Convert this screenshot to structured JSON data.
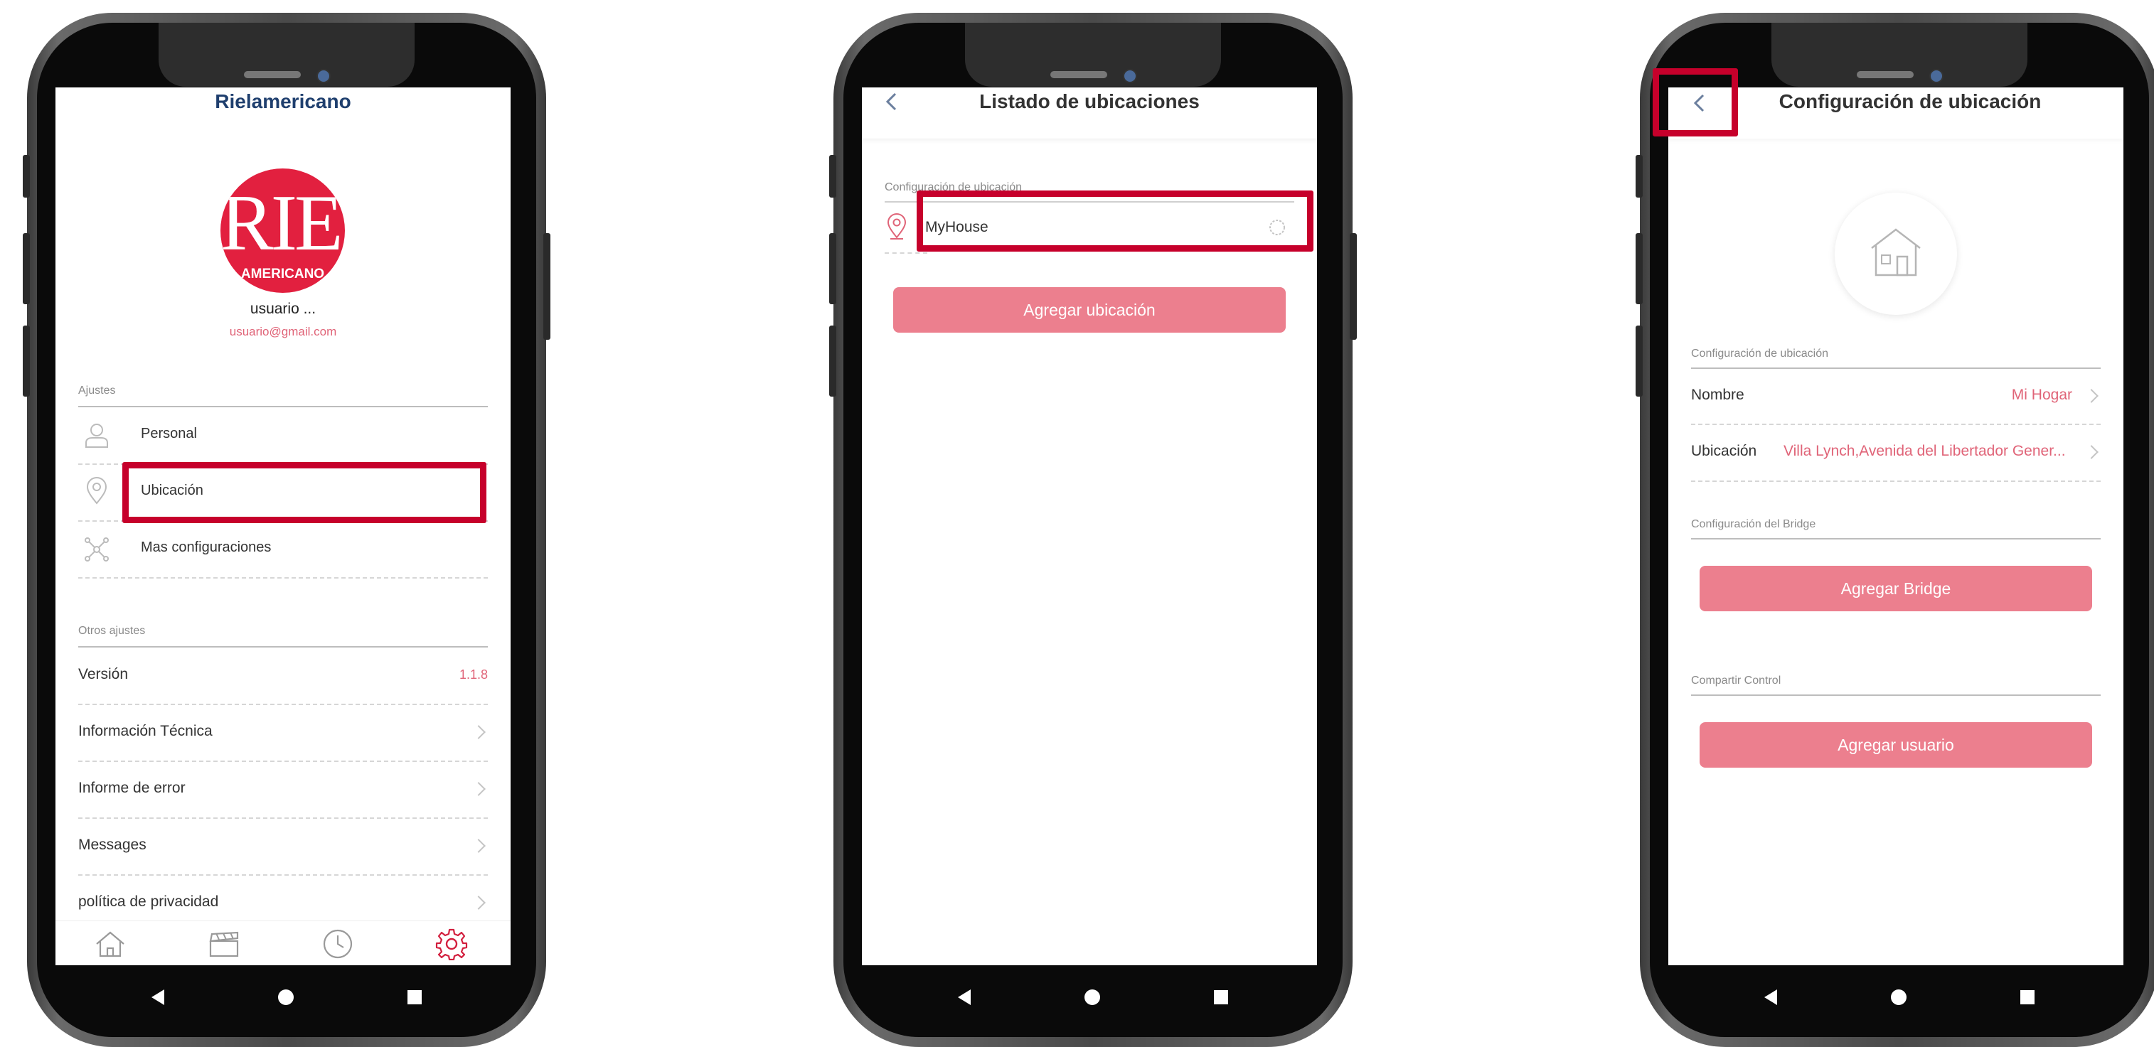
{
  "colors": {
    "accent": "#ec7f8e",
    "highlight": "#c6002b",
    "title_blue": "#1f3f6e"
  },
  "screen1": {
    "title": "Rielamericano",
    "logo_text_top": "RIEL",
    "logo_text_bottom": "AMERICANO",
    "user_name": "usuario ...",
    "user_email": "usuario@gmail.com",
    "section_ajustes": "Ajustes",
    "items": [
      {
        "icon": "person-icon",
        "label": "Personal"
      },
      {
        "icon": "location-pin-icon",
        "label": "Ubicación"
      },
      {
        "icon": "network-icon",
        "label": "Mas configuraciones"
      }
    ],
    "section_otros": "Otros ajustes",
    "version_label": "Versión",
    "version_value": "1.1.8",
    "links": [
      "Información Técnica",
      "Informe de error",
      "Messages",
      "política de privacidad"
    ],
    "tabbar": [
      "home-icon",
      "scenes-icon",
      "clock-icon",
      "settings-icon"
    ]
  },
  "screen2": {
    "title": "Listado de ubicaciones",
    "section": "Configuración de ubicación",
    "location_name": "MyHouse",
    "add_button": "Agregar ubicación"
  },
  "screen3": {
    "title": "Configuración de ubicación",
    "section_location": "Configuración de ubicación",
    "name_label": "Nombre",
    "name_value": "Mi Hogar",
    "location_label": "Ubicación",
    "location_value": "Villa Lynch,Avenida del Libertador Gener...",
    "section_bridge": "Configuración del Bridge",
    "add_bridge": "Agregar Bridge",
    "section_share": "Compartir Control",
    "add_user": "Agregar usuario"
  }
}
